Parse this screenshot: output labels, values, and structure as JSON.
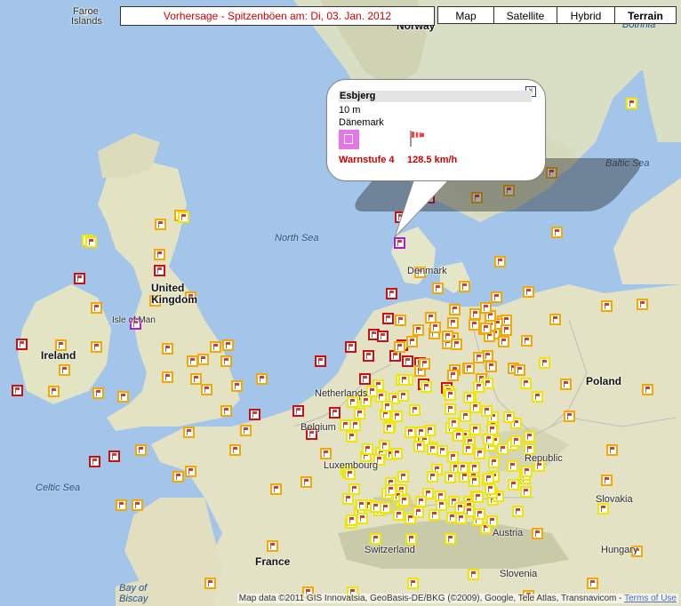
{
  "title": "Vorhersage - Spitzenböen am: Di, 03. Jan. 2012",
  "map_types": [
    {
      "label": "Map",
      "active": false
    },
    {
      "label": "Satellite",
      "active": false
    },
    {
      "label": "Hybrid",
      "active": false
    },
    {
      "label": "Terrain",
      "active": true
    }
  ],
  "info_window": {
    "station": "Esbjerg",
    "elevation": "10 m",
    "country": "Dänemark",
    "warning": "Warnstufe 4",
    "speed": "128.5  km/h",
    "close_icon": "close-icon",
    "windsock_icon": "windsock-icon"
  },
  "place_labels": {
    "faroe": "Faroe",
    "islands": "Islands",
    "norway": "Norway",
    "bothnia": "Bothnia",
    "north_sea": "North Sea",
    "baltic_sea": "Baltic Sea",
    "denmark": "Denmark",
    "united": "United",
    "kingdom": "Kingdom",
    "isle_of_man": "Isle of Man",
    "ireland": "Ireland",
    "celtic_sea": "Celtic Sea",
    "netherlands": "Netherlands",
    "belgium": "Belgium",
    "luxembourg": "Luxembourg",
    "poland": "Poland",
    "czech_republic": "Republic",
    "slovakia": "Slovakia",
    "austria": "Austria",
    "hungary": "Hungary",
    "switzerland": "Switzerland",
    "slovenia": "Slovenia",
    "france": "France",
    "bay_of": "Bay of",
    "biscay": "Biscay"
  },
  "attribution": {
    "text": "Map data ©2011 GIS Innovatsia, GeoBasis-DE/BKG (©2009), Google, Tele Atlas, Transnavicom - ",
    "link": "Terms of Use"
  },
  "legend_colors": {
    "level1": "#f1e600",
    "level2": "#f5a800",
    "level3": "#cc1010",
    "level4": "#b21bd6"
  },
  "stations_by_level": {
    "level4": 2,
    "level3": 26,
    "level2": 95,
    "level1": 160
  }
}
